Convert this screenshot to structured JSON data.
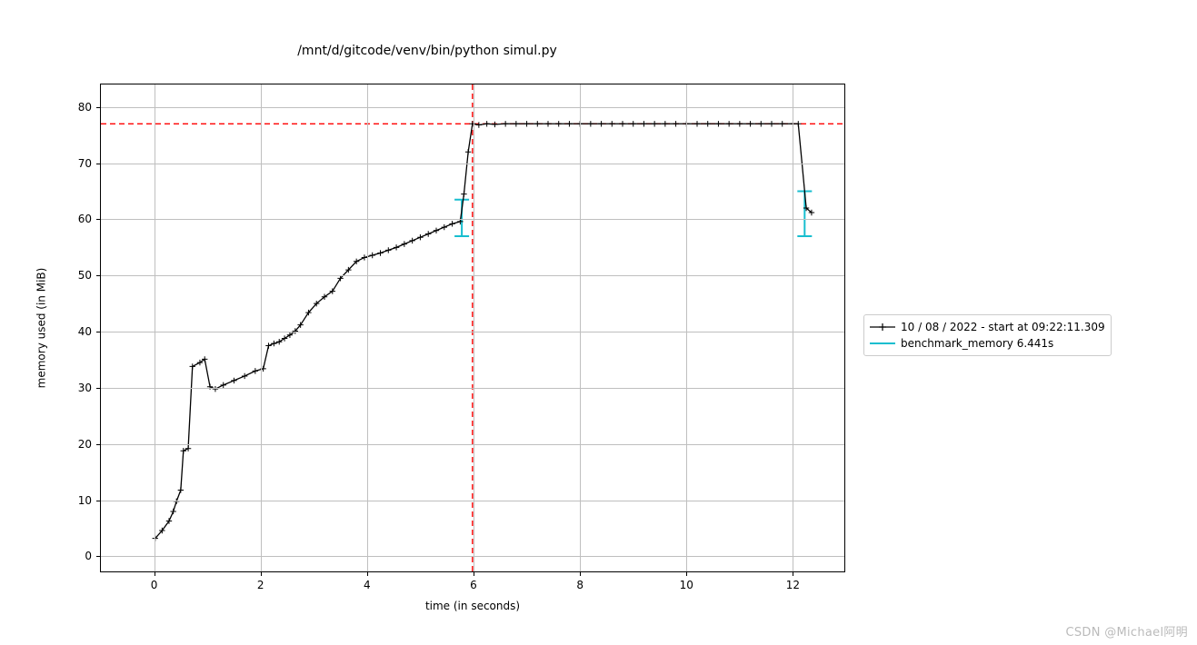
{
  "chart_data": {
    "type": "line",
    "title": "/mnt/d/gitcode/venv/bin/python simul.py",
    "xlabel": "time (in seconds)",
    "ylabel": "memory used (in MiB)",
    "xlim": [
      -1,
      13
    ],
    "ylim": [
      -3,
      84
    ],
    "xticks": [
      0,
      2,
      4,
      6,
      8,
      10,
      12
    ],
    "yticks": [
      0,
      10,
      20,
      30,
      40,
      50,
      60,
      70,
      80
    ],
    "peak_memory": 77,
    "peak_time": 5.98,
    "benchmark_brackets": [
      {
        "x": 5.78,
        "y1": 57,
        "y2": 63.5
      },
      {
        "x": 12.22,
        "y1": 57,
        "y2": 65
      }
    ],
    "series": [
      {
        "name": "10 / 08 / 2022 - start at 09:22:11.309",
        "style": "black-plus",
        "x": [
          0.02,
          0.15,
          0.28,
          0.36,
          0.42,
          0.5,
          0.55,
          0.64,
          0.72,
          0.86,
          0.95,
          1.05,
          1.15,
          1.3,
          1.5,
          1.7,
          1.9,
          2.05,
          2.15,
          2.25,
          2.35,
          2.45,
          2.55,
          2.65,
          2.75,
          2.9,
          3.05,
          3.2,
          3.35,
          3.5,
          3.65,
          3.8,
          3.95,
          4.1,
          4.25,
          4.4,
          4.55,
          4.7,
          4.85,
          5.0,
          5.15,
          5.3,
          5.45,
          5.6,
          5.75,
          5.82,
          5.9,
          5.98,
          6.1,
          6.25,
          6.4,
          6.6,
          6.8,
          7.0,
          7.2,
          7.4,
          7.6,
          7.8,
          8.0,
          8.2,
          8.4,
          8.6,
          8.8,
          9.0,
          9.2,
          9.4,
          9.6,
          9.8,
          10.0,
          10.2,
          10.4,
          10.6,
          10.8,
          11.0,
          11.2,
          11.4,
          11.6,
          11.8,
          12.0,
          12.1,
          12.25,
          12.35
        ],
        "y": [
          3.2,
          4.6,
          6.3,
          8.0,
          9.8,
          11.8,
          18.8,
          19.2,
          33.8,
          34.5,
          35.1,
          30.2,
          29.8,
          30.5,
          31.3,
          32.1,
          33.0,
          33.4,
          37.5,
          37.9,
          38.2,
          38.8,
          39.4,
          40.1,
          41.2,
          43.4,
          45.0,
          46.2,
          47.2,
          49.5,
          51.0,
          52.5,
          53.2,
          53.6,
          54.0,
          54.5,
          55.0,
          55.6,
          56.2,
          56.8,
          57.4,
          58.0,
          58.6,
          59.2,
          59.6,
          64.5,
          72.0,
          77.0,
          76.8,
          77.0,
          76.9,
          77.0,
          77.0,
          77.0,
          77.0,
          77.0,
          77.0,
          77.0,
          77.0,
          77.0,
          77.0,
          77.0,
          77.0,
          77.0,
          77.0,
          77.0,
          77.0,
          77.0,
          77.0,
          77.0,
          77.0,
          77.0,
          77.0,
          77.0,
          77.0,
          77.0,
          77.0,
          77.0,
          77.0,
          77.0,
          62.0,
          61.2
        ]
      }
    ],
    "legend": [
      {
        "label": "10 / 08 / 2022 - start at 09:22:11.309",
        "style": "black-plus"
      },
      {
        "label": "benchmark_memory 6.441s",
        "style": "cyan-bracket"
      }
    ]
  },
  "watermark": "CSDN @Michael阿明",
  "colors": {
    "series_black": "#000000",
    "peak_red": "#ff0000",
    "bracket_cyan": "#17becf",
    "grid": "#bfbfbf"
  }
}
